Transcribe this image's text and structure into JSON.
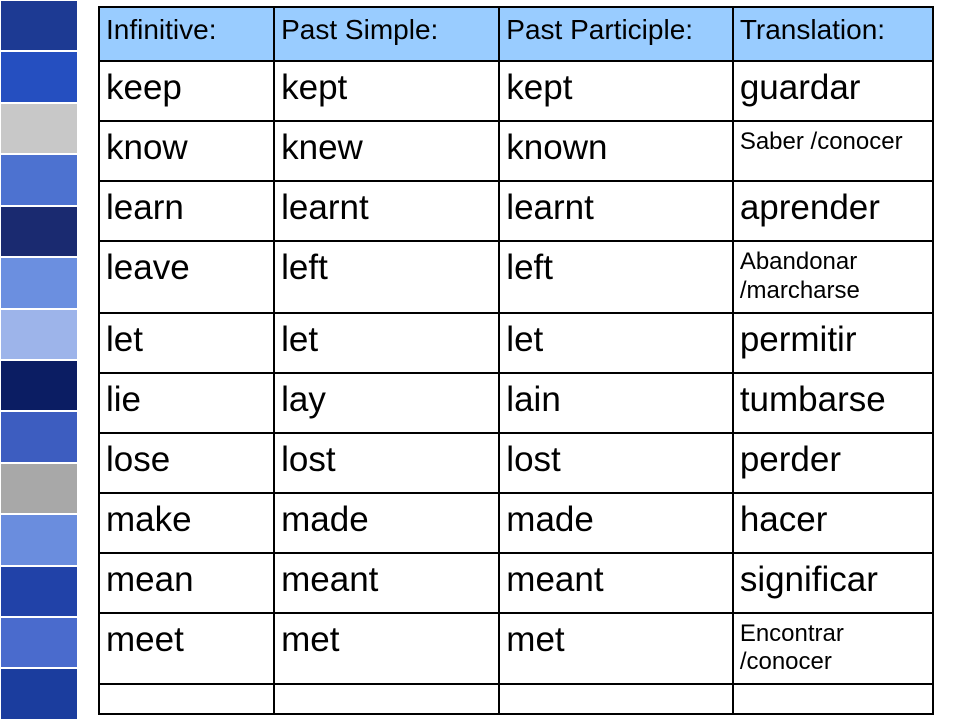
{
  "headers": {
    "infinitive": "Infinitive:",
    "past_simple": "Past Simple:",
    "past_participle": "Past Participle:",
    "translation": "Translation:"
  },
  "rows": [
    {
      "inf": "keep",
      "ps": "kept",
      "pp": "kept",
      "tr": "guardar",
      "tr_small": false
    },
    {
      "inf": "know",
      "ps": "knew",
      "pp": "known",
      "tr": "Saber /conocer",
      "tr_small": true
    },
    {
      "inf": "learn",
      "ps": "learnt",
      "pp": "learnt",
      "tr": "aprender",
      "tr_small": false
    },
    {
      "inf": "leave",
      "ps": "left",
      "pp": "left",
      "tr": "Abandonar /marcharse",
      "tr_small": true
    },
    {
      "inf": "let",
      "ps": "let",
      "pp": "let",
      "tr": "permitir",
      "tr_small": false
    },
    {
      "inf": "lie",
      "ps": "lay",
      "pp": "lain",
      "tr": "tumbarse",
      "tr_small": false
    },
    {
      "inf": "lose",
      "ps": "lost",
      "pp": "lost",
      "tr": "perder",
      "tr_small": false
    },
    {
      "inf": "make",
      "ps": "made",
      "pp": "made",
      "tr": "hacer",
      "tr_small": false
    },
    {
      "inf": "mean",
      "ps": "meant",
      "pp": "meant",
      "tr": "significar",
      "tr_small": false
    },
    {
      "inf": "meet",
      "ps": "met",
      "pp": "met",
      "tr": "Encontrar /conocer",
      "tr_small": true
    }
  ]
}
